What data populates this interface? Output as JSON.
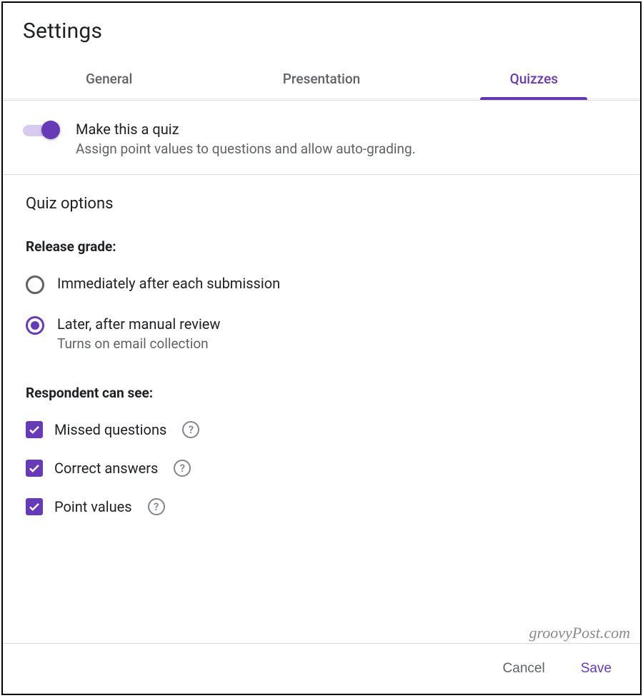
{
  "colors": {
    "accent": "#673ab7",
    "text_primary": "#202124",
    "text_secondary": "#5f6368"
  },
  "header": {
    "title": "Settings"
  },
  "tabs": [
    {
      "label": "General",
      "active": false
    },
    {
      "label": "Presentation",
      "active": false
    },
    {
      "label": "Quizzes",
      "active": true
    }
  ],
  "quiz_toggle": {
    "enabled": true,
    "title": "Make this a quiz",
    "subtitle": "Assign point values to questions and allow auto-grading."
  },
  "quiz_options": {
    "title": "Quiz options",
    "release_grade": {
      "label": "Release grade:",
      "selected_index": 1,
      "options": [
        {
          "label": "Immediately after each submission",
          "hint": ""
        },
        {
          "label": "Later, after manual review",
          "hint": "Turns on email collection"
        }
      ]
    },
    "respondent_can_see": {
      "label": "Respondent can see:",
      "items": [
        {
          "label": "Missed questions",
          "checked": true
        },
        {
          "label": "Correct answers",
          "checked": true
        },
        {
          "label": "Point values",
          "checked": true
        }
      ]
    }
  },
  "footer": {
    "cancel": "Cancel",
    "save": "Save"
  },
  "watermark": "groovyPost.com"
}
